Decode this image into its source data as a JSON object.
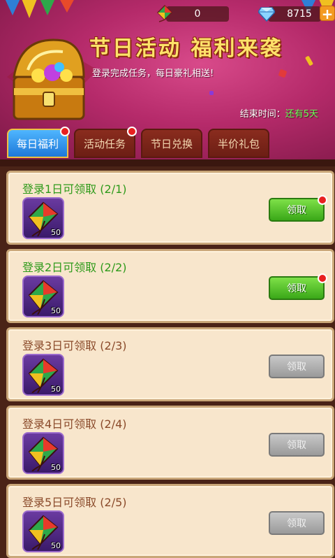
{
  "header": {
    "kite_count": "0",
    "gem_count": "8715",
    "add_symbol": "+",
    "title": "节日活动 福利来袭",
    "subtitle": "登录完成任务，每日豪礼相送!",
    "end_time_label": "结束时间：",
    "end_time_value": "还有5天"
  },
  "tabs": [
    {
      "label": "每日福利",
      "active": true,
      "badge": true
    },
    {
      "label": "活动任务",
      "active": false,
      "badge": true
    },
    {
      "label": "节日兑换",
      "active": false,
      "badge": false
    },
    {
      "label": "半价礼包",
      "active": false,
      "badge": false
    }
  ],
  "rewards": [
    {
      "title": "登录1日可领取 (2/1)",
      "item_count": "50",
      "button": "领取",
      "claimable": true
    },
    {
      "title": "登录2日可领取 (2/2)",
      "item_count": "50",
      "button": "领取",
      "claimable": true
    },
    {
      "title": "登录3日可领取 (2/3)",
      "item_count": "50",
      "button": "领取",
      "claimable": false
    },
    {
      "title": "登录4日可领取 (2/4)",
      "item_count": "50",
      "button": "领取",
      "claimable": false
    },
    {
      "title": "登录5日可领取 (2/5)",
      "item_count": "50",
      "button": "领取",
      "claimable": false
    }
  ],
  "colors": {
    "claim_active": "#3aa818",
    "claim_disabled": "#9a9a9a",
    "active_tab": "#1e78d8",
    "banner": "#b52a6a"
  },
  "icons": [
    "kite-icon",
    "diamond-icon",
    "plus-icon",
    "treasure-chest-icon",
    "red-dot-badge"
  ]
}
